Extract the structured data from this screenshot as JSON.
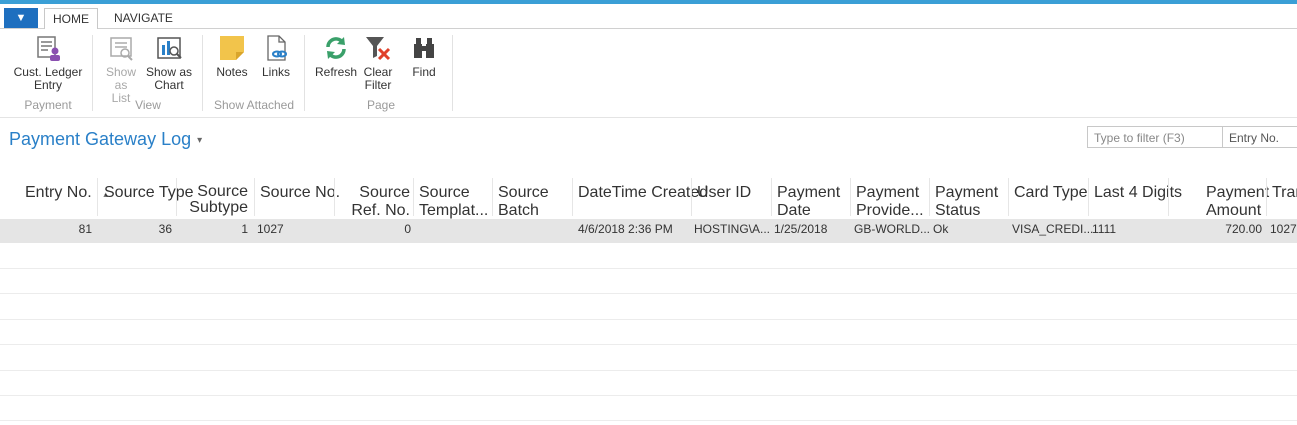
{
  "ribbon_tabs": [
    "HOME",
    "NAVIGATE"
  ],
  "app_menu_glyph": "▼",
  "groups": {
    "payment": {
      "label": "Payment",
      "cust_ledger": "Cust. Ledger Entry"
    },
    "view": {
      "label": "View",
      "show_list": "Show as List",
      "show_chart": "Show as Chart"
    },
    "show_attached": {
      "label": "Show Attached",
      "notes": "Notes",
      "links": "Links"
    },
    "page": {
      "label": "Page",
      "refresh": "Refresh",
      "clear_filter": "Clear Filter",
      "find": "Find"
    }
  },
  "page_title": "Payment Gateway Log",
  "filter": {
    "placeholder": "Type to filter (F3)",
    "field": "Entry No."
  },
  "columns": [
    "Entry No.",
    "Source Type",
    "Source Subtype",
    "Source No.",
    "Source Ref. No.",
    "Source Templat...",
    "Source Batch Name",
    "DateTime Created",
    "User ID",
    "Payment Date",
    "Payment Provide...",
    "Payment Status",
    "Card Type",
    "Last 4 Digits",
    "Payment Amount",
    "Trans"
  ],
  "rows": [
    {
      "entry_no": "81",
      "source_type": "36",
      "source_subtype": "1",
      "source_no": "1027",
      "source_ref_no": "0",
      "source_template": "",
      "source_batch": "",
      "datetime_created": "4/6/2018 2:36 PM",
      "user_id": "HOSTING\\A...",
      "payment_date": "1/25/2018",
      "payment_provider": "GB-WORLD...",
      "payment_status": "Ok",
      "card_type": "VISA_CREDI...",
      "last4": "1111",
      "amount": "720.00",
      "trans": "1027"
    }
  ],
  "colors": {
    "accent": "#2a80c8",
    "topbar": "#3a9fd6",
    "selected_row": "#e5e5e5"
  }
}
